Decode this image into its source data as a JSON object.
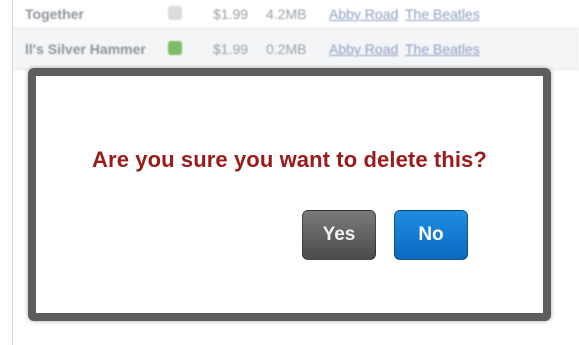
{
  "background_tracks": [
    {
      "song": "Together",
      "price": "$1.99",
      "size": "4.2MB",
      "album": "Abby Road",
      "artist": "The Beatles"
    },
    {
      "song": "ll's Silver Hammer",
      "price": "$1.99",
      "size": "0.2MB",
      "album": "Abby Road",
      "artist": "The Beatles"
    }
  ],
  "dialog": {
    "message": "Are you sure you want to delete this?",
    "yes_label": "Yes",
    "no_label": "No"
  },
  "colors": {
    "message": "#9b1a1a",
    "yes_button": "#5e5e5e",
    "no_button": "#1279d2",
    "dialog_border": "#5d5d5d"
  }
}
